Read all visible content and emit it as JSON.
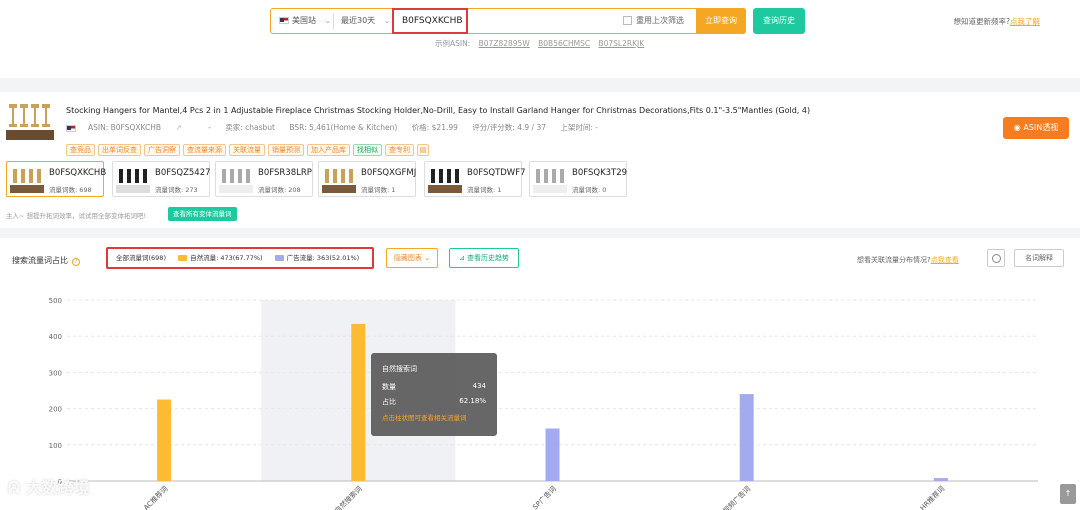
{
  "search": {
    "marketplace": "美国站",
    "period": "最近30天",
    "asin_value": "B0FSQXKCHB",
    "reuse_label": "重用上次筛选",
    "query_button": "立即查询",
    "history_button": "查询历史",
    "example_label": "示例ASIN:",
    "examples": [
      "B07Z82895W",
      "B0B56CHMSC",
      "B07SL2RKJK"
    ],
    "freq_text": "想知道更新频率?",
    "freq_link": "点我了解"
  },
  "product": {
    "title": "Stocking Hangers for Mantel,4 Pcs 2 in 1 Adjustable Fireplace Christmas Stocking Holder,No-Drill, Easy to Install Garland Hanger for Christmas Decorations,Fits 0.1\"-3.5\"Mantles (Gold, 4)",
    "asin": "ASIN: B0FSQXKCHB",
    "sep": "-",
    "seller": "卖家: chasbut",
    "bsr": "BSR: 5,461(Home & Kitchen)",
    "price": "价格: $21.99",
    "rating": "评分/评分数: 4.9 / 37",
    "listed": "上架时间: -",
    "tags": [
      "查竞品",
      "出单词反查",
      "广告洞察",
      "查流量来源",
      "关联流量",
      "销量预测",
      "加入产品库",
      "找相似",
      "查专利"
    ],
    "asin_button": "ASIN透视"
  },
  "variants": [
    {
      "asin": "B0FSQXKCHB",
      "count": "流量词数: 698"
    },
    {
      "asin": "B0FSQZ5427",
      "count": "流量词数: 273"
    },
    {
      "asin": "B0FSR38LRP",
      "count": "流量词数: 208"
    },
    {
      "asin": "B0FSQXGFMJ",
      "count": "流量词数: 1"
    },
    {
      "asin": "B0FSQTDWF7",
      "count": "流量词数: 1"
    },
    {
      "asin": "B0FSQK3T29",
      "count": "流量词数: 0"
    }
  ],
  "variant_hint": "主人~ 想提升拓词效率，试试用全部变体拓词吧!",
  "variant_button": "查看所有变体流量词",
  "chart_section": {
    "title": "搜索流量词占比",
    "legend_all": "全部流量词(698)",
    "legend_organic": "自然流量: 473(67.77%)",
    "legend_ad": "广告流量: 363(52.01%)",
    "hide_button": "隐藏图表",
    "trend_button": "查看历史趋势",
    "related_text": "想看关联流量分布情况?",
    "related_link": "点我查看",
    "explain_button": "名词解释",
    "colors": {
      "organic": "#fbbb32",
      "ad": "#a3aaf0"
    }
  },
  "tooltip": {
    "title": "自然搜索词",
    "count_label": "数量",
    "count_value": "434",
    "ratio_label": "占比",
    "ratio_value": "62.18%",
    "link": "点击柱状图可查看相关流量词"
  },
  "watermark": "大数跨境",
  "chart_data": {
    "type": "bar",
    "categories": [
      "AC推荐词",
      "自然搜索词",
      "SP广告词",
      "视频广告词",
      "HR推荐词"
    ],
    "series": [
      {
        "name": "自然流量",
        "values": [
          225,
          434,
          null,
          null,
          null
        ]
      },
      {
        "name": "广告流量",
        "values": [
          null,
          null,
          145,
          240,
          8
        ]
      }
    ],
    "yticks": [
      0,
      100,
      200,
      300,
      400,
      500
    ],
    "ylim": [
      0,
      500
    ],
    "highlight_index": 1
  }
}
